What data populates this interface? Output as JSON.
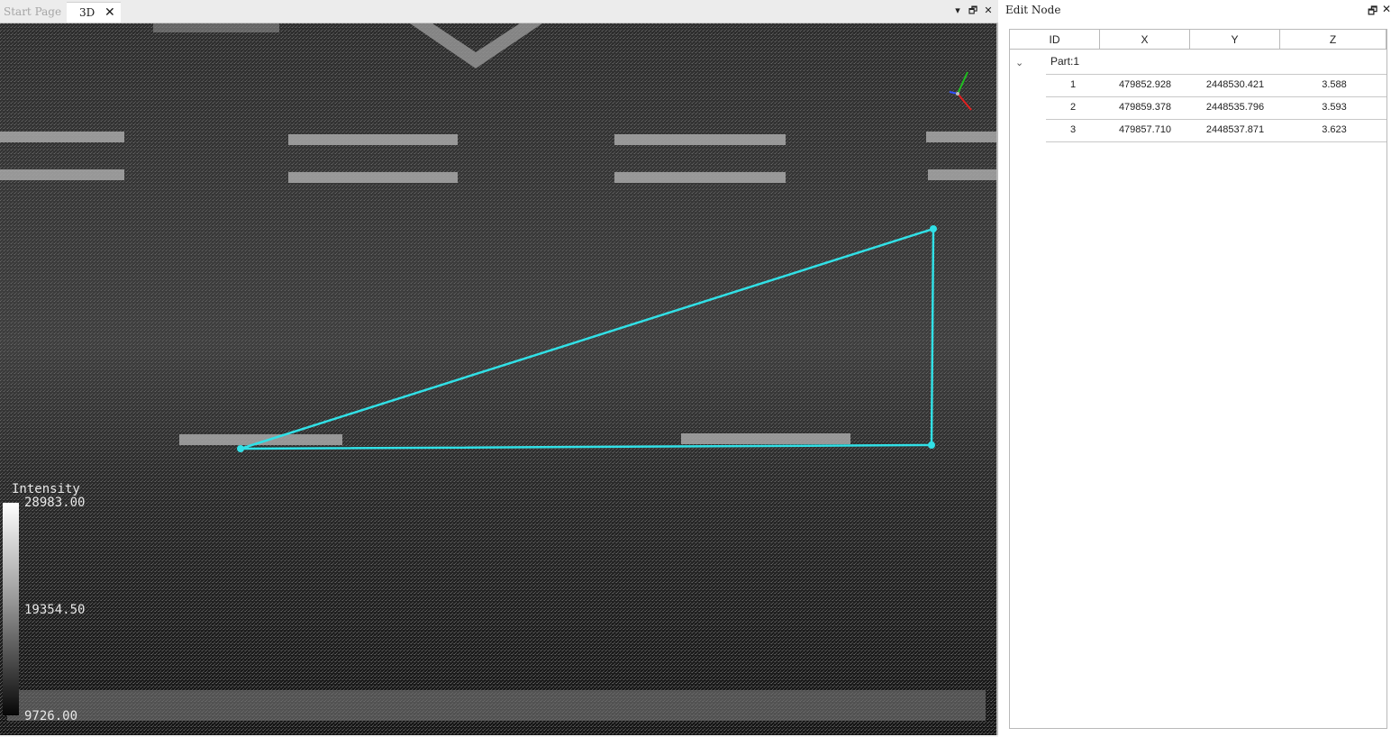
{
  "tabs": [
    {
      "label": "Start Page",
      "active": false
    },
    {
      "label": "3D",
      "active": true,
      "close": "✕"
    }
  ],
  "pane_controls": {
    "dropdown": "▾",
    "restore": "🗗",
    "close": "✕"
  },
  "viewport": {
    "background_color": "#3a3a3a",
    "polyline_color": "#31e0e6",
    "axis_colors": {
      "x": "#e02020",
      "y": "#20c020",
      "z": "#3050ff"
    }
  },
  "colorbar": {
    "title": "Intensity",
    "max_label": "28983.00",
    "mid_label": "19354.50",
    "min_label": "9726.00"
  },
  "edit_node": {
    "title": "Edit Node",
    "restore_icon": "🗗",
    "close_icon": "✕",
    "columns": [
      "ID",
      "X",
      "Y",
      "Z"
    ],
    "group": {
      "caret": "⌄",
      "label": "Part:1"
    },
    "rows": [
      {
        "id": "1",
        "x": "479852.928",
        "y": "2448530.421",
        "z": "3.588"
      },
      {
        "id": "2",
        "x": "479859.378",
        "y": "2448535.796",
        "z": "3.593"
      },
      {
        "id": "3",
        "x": "479857.710",
        "y": "2448537.871",
        "z": "3.623"
      }
    ]
  }
}
